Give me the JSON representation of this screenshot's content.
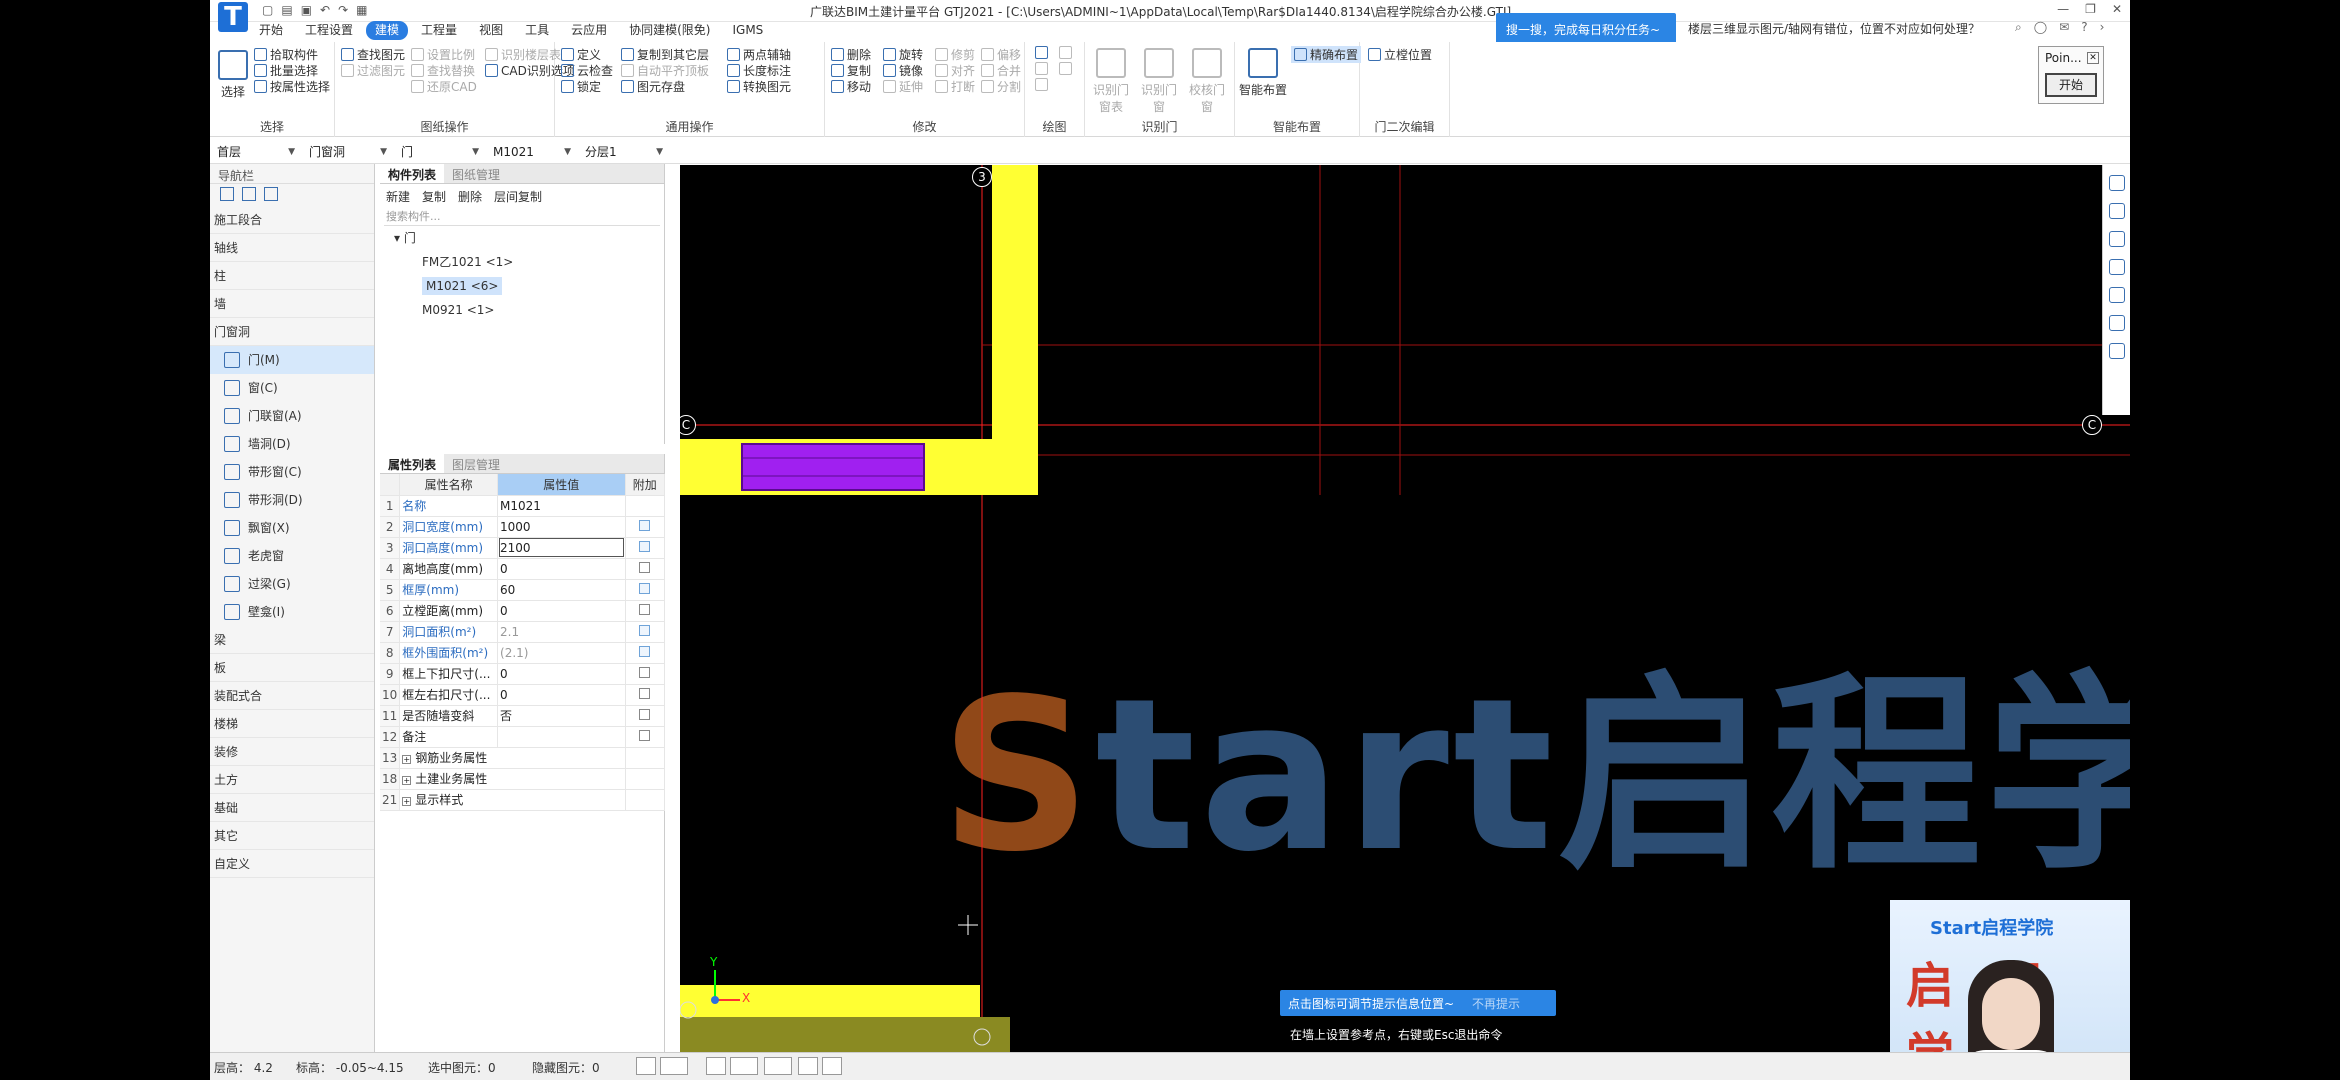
{
  "title_bar": {
    "app_title": "广联达BIM土建计量平台 GTJ2021 - [C:\\Users\\ADMINI~1\\AppData\\Local\\Temp\\Rar$DIa1440.8134\\启程学院综合办公楼.GTJ]",
    "logo": "T",
    "quick_access": [
      "new-icon",
      "open-icon",
      "save-icon",
      "undo-icon",
      "redo-icon",
      "print-icon"
    ]
  },
  "menu": {
    "tabs": [
      "开始",
      "工程设置",
      "建模",
      "工程量",
      "视图",
      "工具",
      "云应用",
      "协同建模(限免)",
      "IGMS"
    ],
    "active": "建模"
  },
  "search_tip": "搜一搜，完成每日积分任务~",
  "help_question": "楼层三维显示图元/轴网有错位，位置不对应如何处理？",
  "ribbon": {
    "select": {
      "label": "选择",
      "big": "选择",
      "items": [
        "拾取构件",
        "批量选择",
        "按属性选择"
      ]
    },
    "drawing_ops": {
      "label": "图纸操作",
      "items": [
        "查找图元",
        "过滤图元",
        "设置比例",
        "识别楼层表",
        "查找替换",
        "CAD识别选项",
        "还原CAD"
      ]
    },
    "common_ops": {
      "label": "通用操作",
      "items": [
        "定义",
        "复制到其它层",
        "两点辅轴",
        "云检查",
        "自动平齐顶板",
        "长度标注",
        "锁定",
        "图元存盘",
        "转换图元"
      ]
    },
    "modify": {
      "label": "修改",
      "items": [
        "删除",
        "旋转",
        "修剪",
        "偏移",
        "复制",
        "镜像",
        "对齐",
        "合并",
        "移动",
        "延伸",
        "打断",
        "分割"
      ]
    },
    "draw": {
      "label": "绘图"
    },
    "recognize_door": {
      "label": "识别门",
      "items": [
        "识别门窗表",
        "识别门窗",
        "校核门窗"
      ]
    },
    "smart_layout": {
      "label": "智能布置",
      "big": "智能布置",
      "items": [
        "精确布置"
      ]
    },
    "door_secondary": {
      "label": "门二次编辑",
      "items": [
        "立樘位置"
      ]
    }
  },
  "point_box": {
    "title": "Poin...",
    "button": "开始"
  },
  "selectors": [
    "首层",
    "门窗洞",
    "门",
    "M1021",
    "分层1"
  ],
  "nav": {
    "header": "导航栏",
    "categories": [
      "施工段合",
      "轴线",
      "柱",
      "墙",
      "门窗洞"
    ],
    "subitems": [
      "门(M)",
      "窗(C)",
      "门联窗(A)",
      "墙洞(D)",
      "带形窗(C)",
      "带形洞(D)",
      "飘窗(X)",
      "老虎窗",
      "过梁(G)",
      "壁龛(I)"
    ],
    "active_subitem": "门(M)",
    "categories_after": [
      "梁",
      "板",
      "装配式合",
      "楼梯",
      "装修",
      "土方",
      "基础",
      "其它",
      "自定义"
    ]
  },
  "component_list": {
    "tabs": [
      "构件列表",
      "图纸管理"
    ],
    "tools": [
      "新建",
      "复制",
      "删除",
      "层间复制"
    ],
    "search_placeholder": "搜索构件...",
    "root": "门",
    "items": [
      "FM乙1021 <1>",
      "M1021 <6>",
      "M0921 <1>"
    ],
    "active_index": 1
  },
  "properties": {
    "tabs": [
      "属性列表",
      "图层管理"
    ],
    "headers": [
      "属性名称",
      "属性值",
      "附加"
    ],
    "rows": [
      {
        "n": "1",
        "name": "名称",
        "value": "M1021",
        "blue": true,
        "gray": false,
        "chk": false
      },
      {
        "n": "2",
        "name": "洞口宽度(mm)",
        "value": "1000",
        "blue": true,
        "gray": false,
        "chk": true
      },
      {
        "n": "3",
        "name": "洞口高度(mm)",
        "value": "2100",
        "blue": true,
        "gray": false,
        "chk": true
      },
      {
        "n": "4",
        "name": "离地高度(mm)",
        "value": "0",
        "blue": false,
        "gray": false,
        "chk": true
      },
      {
        "n": "5",
        "name": "框厚(mm)",
        "value": "60",
        "blue": true,
        "gray": false,
        "chk": true
      },
      {
        "n": "6",
        "name": "立樘距离(mm)",
        "value": "0",
        "blue": false,
        "gray": false,
        "chk": true
      },
      {
        "n": "7",
        "name": "洞口面积(m²)",
        "value": "2.1",
        "blue": true,
        "gray": true,
        "chk": true
      },
      {
        "n": "8",
        "name": "框外围面积(m²)",
        "value": "(2.1)",
        "blue": true,
        "gray": true,
        "chk": true
      },
      {
        "n": "9",
        "name": "框上下扣尺寸(...",
        "value": "0",
        "blue": false,
        "gray": false,
        "chk": true
      },
      {
        "n": "10",
        "name": "框左右扣尺寸(...",
        "value": "0",
        "blue": false,
        "gray": false,
        "chk": true
      },
      {
        "n": "11",
        "name": "是否随墙变斜",
        "value": "否",
        "blue": false,
        "gray": false,
        "chk": true
      },
      {
        "n": "12",
        "name": "备注",
        "value": "",
        "blue": false,
        "gray": false,
        "chk": true
      }
    ],
    "groups": [
      {
        "n": "13",
        "name": "钢筋业务属性"
      },
      {
        "n": "18",
        "name": "土建业务属性"
      },
      {
        "n": "21",
        "name": "显示样式"
      }
    ]
  },
  "canvas": {
    "axis_labels": [
      "3",
      "C",
      "C"
    ],
    "watermark": "Start启程学院",
    "y_label": "Y",
    "x_label": "X",
    "hint": "点击图标可调节提示信息位置~",
    "hint_off": "不再提示",
    "command": "在墙上设置参考点，右键或Esc退出命令"
  },
  "webcam": {
    "brand": "Start启程学院",
    "big": "启程学院"
  },
  "status": {
    "floor_height": "层高：  4.2",
    "elevation": "标高：  -0.05~4.15",
    "selected": "选中图元：0",
    "hidden": "隐藏图元：0"
  },
  "colors": {
    "accent": "#2a7de1",
    "wall": "#ffff33",
    "door": "#a020f0",
    "axis": "#ff2020"
  }
}
